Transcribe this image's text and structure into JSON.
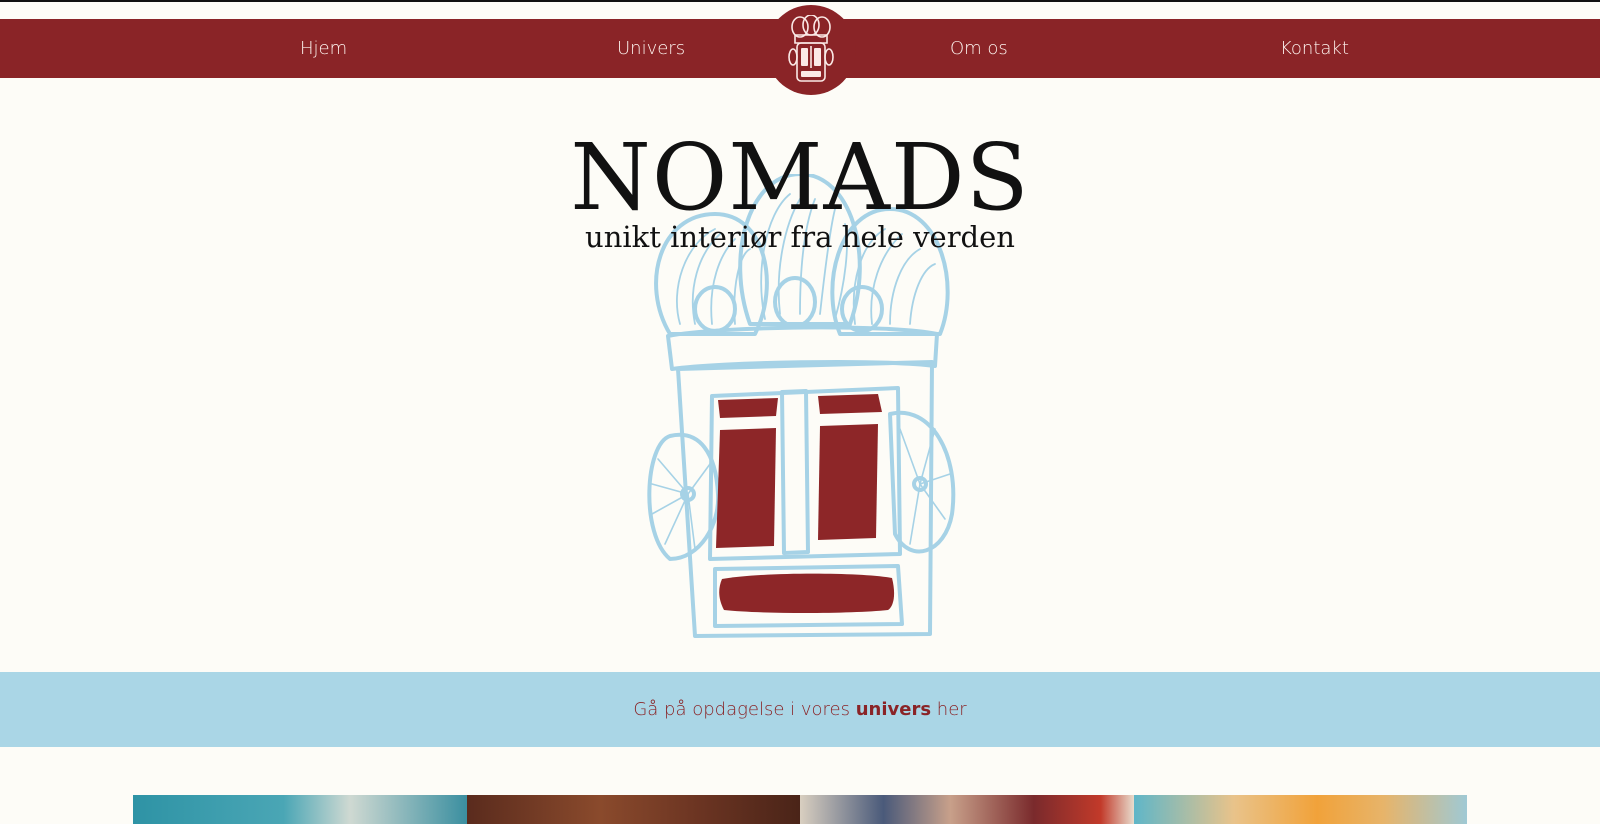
{
  "nav": {
    "items": [
      {
        "label": "Hjem"
      },
      {
        "label": "Univers"
      },
      {
        "label": "Om os"
      },
      {
        "label": "Kontakt"
      }
    ],
    "logo_icon": "mask-logo-icon"
  },
  "hero": {
    "title": "NOMADS",
    "subtitle": "unikt interiør fra hele verden",
    "illustration_icon": "mask-illustration"
  },
  "band": {
    "text_before": "Gå på opdagelse i vores ",
    "link_text": "univers",
    "text_after": " her"
  },
  "gallery": {
    "tiles": [
      {
        "icon": "gallery-image-1"
      },
      {
        "icon": "gallery-image-2"
      },
      {
        "icon": "gallery-image-3"
      },
      {
        "icon": "gallery-image-4"
      }
    ]
  },
  "colors": {
    "brand_red": "#8a2427",
    "accent_blue": "#aad6e6",
    "background": "#fdfcf7",
    "mask_outline": "#a6d2e6"
  }
}
